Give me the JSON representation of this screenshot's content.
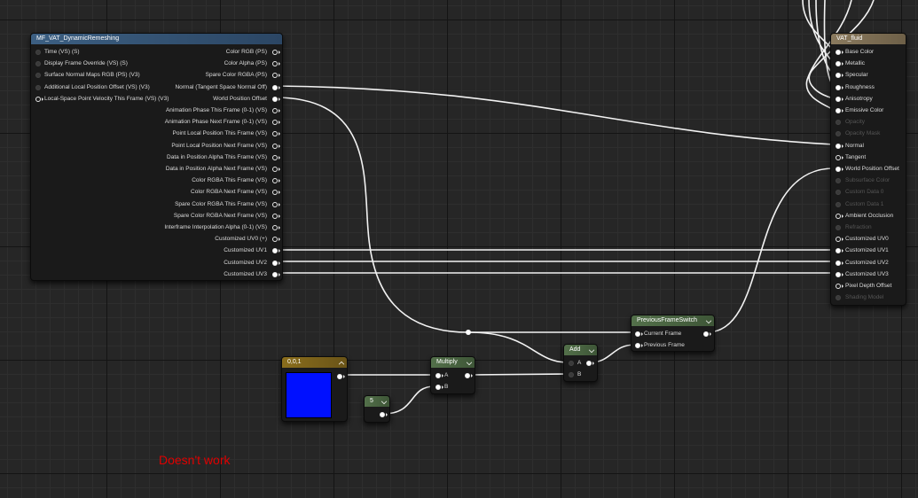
{
  "mf_node": {
    "title": "MF_VAT_DynamicRemeshing",
    "inputs": [
      "Time (VS) (S)",
      "Display Frame Override (VS) (S)",
      "Surface Normal Maps RGB (PS) (V3)",
      "Additional Local Position Offset (VS) (V3)",
      "Local-Space Point Velocity This Frame (VS) (V3)"
    ],
    "outputs": [
      "Color RGB (PS)",
      "Color Alpha (PS)",
      "Spare Color RGBA (PS)",
      "Normal (Tangent Space Normal Off)",
      "World Position Offset",
      "Animation Phase This Frame (0-1) (VS)",
      "Animation Phase Next Frame (0-1) (VS)",
      "Point Local Position This Frame (VS)",
      "Point Local Position Next Frame (VS)",
      "Data in Position Alpha This Frame (VS)",
      "Data in Position Alpha Next Frame (VS)",
      "Color RGBA This Frame (VS)",
      "Color RGBA Next Frame (VS)",
      "Spare Color RGBA This Frame (VS)",
      "Spare Color RGBA Next Frame (VS)",
      "Interframe Interpolation Alpha (0-1) (VS)",
      "Customized UV0 (+)",
      "Customized UV1",
      "Customized UV2",
      "Customized UV3"
    ]
  },
  "vat_node": {
    "title": "VAT_fluid",
    "pins": [
      {
        "label": "Base Color",
        "active": true
      },
      {
        "label": "Metallic",
        "active": true
      },
      {
        "label": "Specular",
        "active": true
      },
      {
        "label": "Roughness",
        "active": true
      },
      {
        "label": "Anisotropy",
        "active": true
      },
      {
        "label": "Emissive Color",
        "active": true
      },
      {
        "label": "Opacity",
        "active": false
      },
      {
        "label": "Opacity Mask",
        "active": false
      },
      {
        "label": "Normal",
        "active": true
      },
      {
        "label": "Tangent",
        "active": true
      },
      {
        "label": "World Position Offset",
        "active": true
      },
      {
        "label": "Subsurface Color",
        "active": false
      },
      {
        "label": "Custom Data 0",
        "active": false
      },
      {
        "label": "Custom Data 1",
        "active": false
      },
      {
        "label": "Ambient Occlusion",
        "active": true
      },
      {
        "label": "Refraction",
        "active": false
      },
      {
        "label": "Customized UV0",
        "active": true
      },
      {
        "label": "Customized UV1",
        "active": true
      },
      {
        "label": "Customized UV2",
        "active": true
      },
      {
        "label": "Customized UV3",
        "active": true
      },
      {
        "label": "Pixel Depth Offset",
        "active": true
      },
      {
        "label": "Shading Model",
        "active": false
      }
    ]
  },
  "const_node": {
    "title": "0,0,1",
    "color": "#0010ff"
  },
  "scalar_node": {
    "title": "5"
  },
  "multiply_node": {
    "title": "Multiply",
    "inputs": [
      "A",
      "B"
    ]
  },
  "add_node": {
    "title": "Add",
    "inputs": [
      "A",
      "B"
    ]
  },
  "switch_node": {
    "title": "PreviousFrameSwitch",
    "inputs": [
      "Current Frame",
      "Previous Frame"
    ]
  },
  "annotation": {
    "text": "Doesn't work",
    "color": "#e00000"
  }
}
